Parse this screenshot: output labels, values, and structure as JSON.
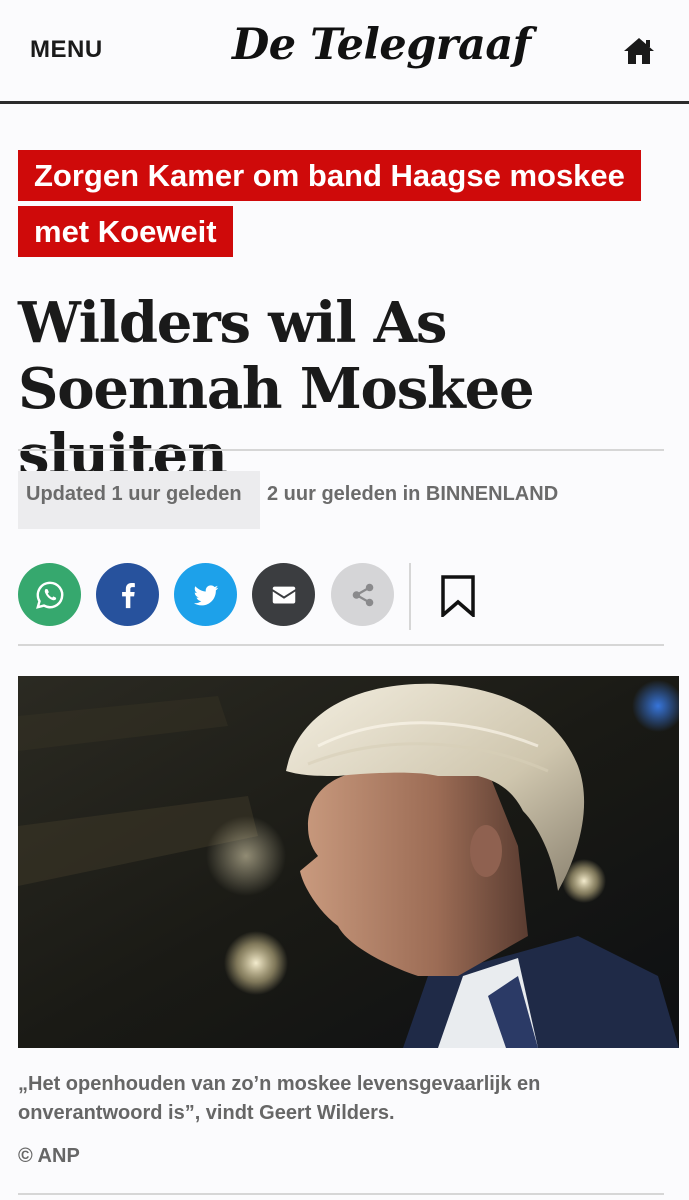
{
  "header": {
    "menu_label": "MENU",
    "logo_text": "De Telegraaf",
    "home_icon": "home-icon"
  },
  "article": {
    "kicker": "Zorgen Kamer om band Haagse moskee met Koeweit",
    "headline": "Wilders wil As Soennah Moskee sluiten",
    "updated": "Updated 1 uur geleden",
    "published": "2 uur geleden in BINNENLAND",
    "caption": "„Het openhouden van zo’n moskee levensgevaarlijk en onverantwoord is”, vindt Geert Wilders.",
    "credit": "© ANP"
  },
  "share": {
    "buttons": [
      {
        "name": "whatsapp",
        "icon": "whatsapp-icon",
        "color": "#36a86e"
      },
      {
        "name": "facebook",
        "icon": "facebook-icon",
        "color": "#27529d"
      },
      {
        "name": "twitter",
        "icon": "twitter-icon",
        "color": "#1da1ea"
      },
      {
        "name": "email",
        "icon": "envelope-icon",
        "color": "#3b3d40"
      },
      {
        "name": "more",
        "icon": "share-icon",
        "color": "#d5d5d7"
      }
    ],
    "bookmark_icon": "bookmark-icon"
  },
  "colors": {
    "kicker_bg": "#cf0a0a",
    "header_rule": "#2b2b2b",
    "meta_text": "#6b6b6b"
  }
}
